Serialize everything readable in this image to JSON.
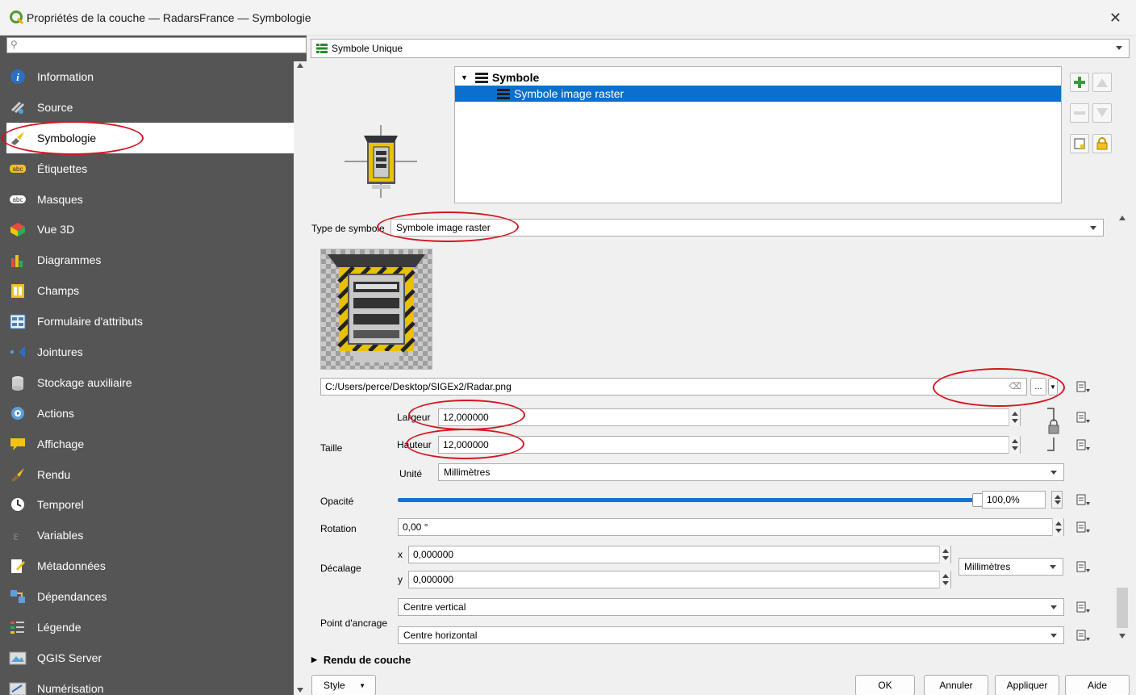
{
  "window": {
    "title": "Propriétés de la couche — RadarsFrance — Symbologie",
    "close": "✕"
  },
  "sidebar": {
    "search_placeholder": "",
    "active_index": 2,
    "items": [
      {
        "label": "Information",
        "icon": "info-icon"
      },
      {
        "label": "Source",
        "icon": "source-icon"
      },
      {
        "label": "Symbologie",
        "icon": "symbology-icon"
      },
      {
        "label": "Étiquettes",
        "icon": "labels-icon"
      },
      {
        "label": "Masques",
        "icon": "masks-icon"
      },
      {
        "label": "Vue 3D",
        "icon": "3d-view-icon"
      },
      {
        "label": "Diagrammes",
        "icon": "diagrams-icon"
      },
      {
        "label": "Champs",
        "icon": "fields-icon"
      },
      {
        "label": "Formulaire d'attributs",
        "icon": "attributes-form-icon"
      },
      {
        "label": "Jointures",
        "icon": "joins-icon"
      },
      {
        "label": "Stockage auxiliaire",
        "icon": "auxiliary-storage-icon"
      },
      {
        "label": "Actions",
        "icon": "actions-icon"
      },
      {
        "label": "Affichage",
        "icon": "display-icon"
      },
      {
        "label": "Rendu",
        "icon": "rendering-icon"
      },
      {
        "label": "Temporel",
        "icon": "temporal-icon"
      },
      {
        "label": "Variables",
        "icon": "variables-icon"
      },
      {
        "label": "Métadonnées",
        "icon": "metadata-icon"
      },
      {
        "label": "Dépendances",
        "icon": "dependencies-icon"
      },
      {
        "label": "Légende",
        "icon": "legend-icon"
      },
      {
        "label": "QGIS Server",
        "icon": "qgis-server-icon"
      },
      {
        "label": "Numérisation",
        "icon": "digitizing-icon"
      }
    ]
  },
  "renderer": {
    "selected": "Symbole Unique"
  },
  "symbol_tree": {
    "root": "Symbole",
    "child": "Symbole image raster"
  },
  "symbol_layer": {
    "type_label": "Type de symbole",
    "type_value": "Symbole image raster",
    "file_path": "C:/Users/perce/Desktop/SIGEx2/Radar.png",
    "browse_label": "...",
    "size_label": "Taille",
    "width_label": "Largeur",
    "width_value": "12,000000",
    "height_label": "Hauteur",
    "height_value": "12,000000",
    "unit_label": "Unité",
    "unit_value": "Millimètres",
    "opacity_label": "Opacité",
    "opacity_value": "100,0%",
    "opacity_fraction": 1.0,
    "rotation_label": "Rotation",
    "rotation_value": "0,00 °",
    "offset_label": "Décalage",
    "offset_x_label": "x",
    "offset_x_value": "0,000000",
    "offset_y_label": "y",
    "offset_y_value": "0,000000",
    "offset_unit": "Millimètres",
    "anchor_label": "Point d'ancrage",
    "anchor_vertical": "Centre vertical",
    "anchor_horizontal": "Centre horizontal"
  },
  "layer_rendering": {
    "label": "Rendu de couche"
  },
  "buttons": {
    "style": "Style",
    "ok": "OK",
    "cancel": "Annuler",
    "apply": "Appliquer",
    "help": "Aide"
  },
  "colors": {
    "sidebar_bg": "#555555",
    "selection_blue": "#0b6fce",
    "annotation_red": "#d3161f",
    "slider_blue": "#1174d6"
  }
}
